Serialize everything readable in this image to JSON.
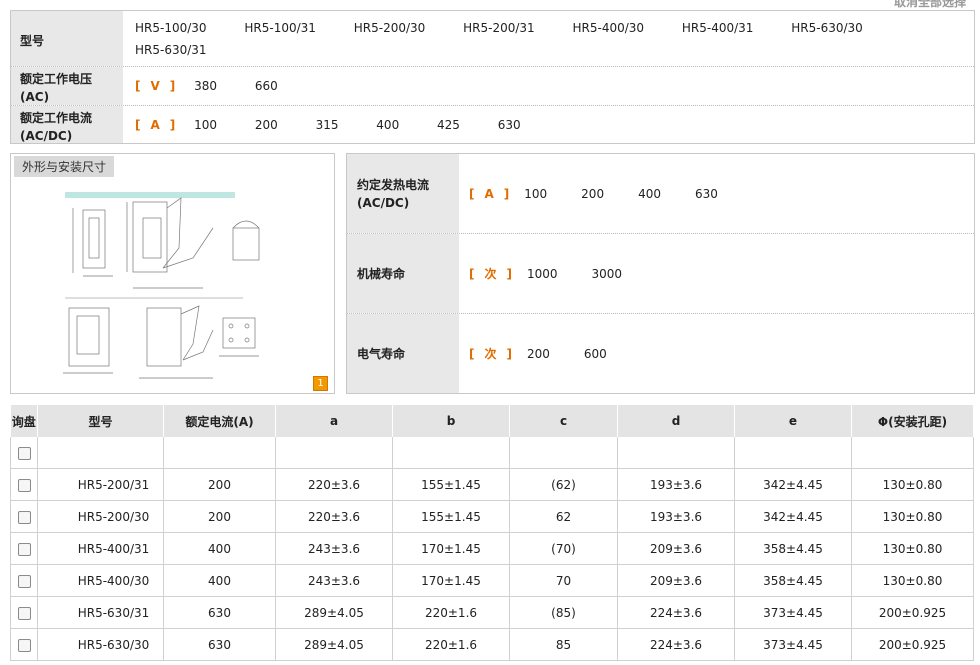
{
  "top_link": "取消全部选择",
  "spec": {
    "model_label": "型号",
    "models": [
      "HR5-100/30",
      "HR5-100/31",
      "HR5-200/30",
      "HR5-200/31",
      "HR5-400/30",
      "HR5-400/31",
      "HR5-630/30",
      "HR5-630/31"
    ],
    "voltage_label": "额定工作电压(AC)",
    "voltage_unit": "V",
    "voltages": [
      "380",
      "660"
    ],
    "current_label": "额定工作电流(AC/DC)",
    "current_unit": "A",
    "currents": [
      "100",
      "200",
      "315",
      "400",
      "425",
      "630"
    ]
  },
  "image_panel": {
    "title": "外形与安装尺寸",
    "page": "1"
  },
  "right_panel": [
    {
      "label": "约定发热电流(AC/DC)",
      "unit": "A",
      "values": [
        "100",
        "200",
        "400",
        "630"
      ]
    },
    {
      "label": "机械寿命",
      "unit": "次",
      "values": [
        "1000",
        "3000"
      ]
    },
    {
      "label": "电气寿命",
      "unit": "次",
      "values": [
        "200",
        "600"
      ]
    }
  ],
  "table": {
    "headers": [
      "询盘",
      "型号",
      "额定电流(A)",
      "a",
      "b",
      "c",
      "d",
      "e",
      "Φ(安装孔距)"
    ],
    "rows": [
      [
        "",
        "",
        "",
        "",
        "",
        "",
        "",
        ""
      ],
      [
        "HR5-200/31",
        "200",
        "220±3.6",
        "155±1.45",
        "(62)",
        "193±3.6",
        "342±4.45",
        "130±0.80"
      ],
      [
        "HR5-200/30",
        "200",
        "220±3.6",
        "155±1.45",
        "62",
        "193±3.6",
        "342±4.45",
        "130±0.80"
      ],
      [
        "HR5-400/31",
        "400",
        "243±3.6",
        "170±1.45",
        "(70)",
        "209±3.6",
        "358±4.45",
        "130±0.80"
      ],
      [
        "HR5-400/30",
        "400",
        "243±3.6",
        "170±1.45",
        "70",
        "209±3.6",
        "358±4.45",
        "130±0.80"
      ],
      [
        "HR5-630/31",
        "630",
        "289±4.05",
        "220±1.6",
        "(85)",
        "224±3.6",
        "373±4.45",
        "200±0.925"
      ],
      [
        "HR5-630/30",
        "630",
        "289±4.05",
        "220±1.6",
        "85",
        "224±3.6",
        "373±4.45",
        "200±0.925"
      ]
    ]
  },
  "colors": {
    "accent": "#e06c00",
    "label_bg": "#e8e8e8",
    "border": "#c8c8c8"
  }
}
